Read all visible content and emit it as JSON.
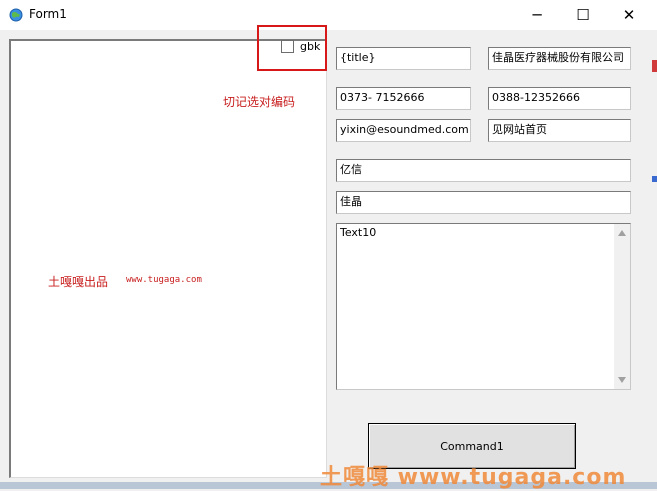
{
  "window": {
    "title": "Form1",
    "icon": "globe-icon"
  },
  "controls": {
    "minimize": "─",
    "maximize": "☐",
    "close": "✕"
  },
  "checkbox": {
    "label": "gbk",
    "checked": false
  },
  "notes": {
    "encoding_tip": "切记选对编码",
    "author": "土嘎嘎出品",
    "site": "www.tugaga.com"
  },
  "fields": {
    "title": "{title}",
    "company": "佳晶医疗器械股份有限公司",
    "phone1": "0373- 7152666",
    "phone2": "0388-12352666",
    "email": "yixin@esoundmed.com",
    "homepage": "见网站首页",
    "text7": "亿信",
    "text8": "佳晶",
    "text10": "Text10"
  },
  "command": {
    "label": "Command1"
  },
  "watermark": "土嘎嘎 www.tugaga.com",
  "colors": {
    "note": "#c81e1e",
    "highlight": "#d61818",
    "watermark": "#f08a3a"
  }
}
